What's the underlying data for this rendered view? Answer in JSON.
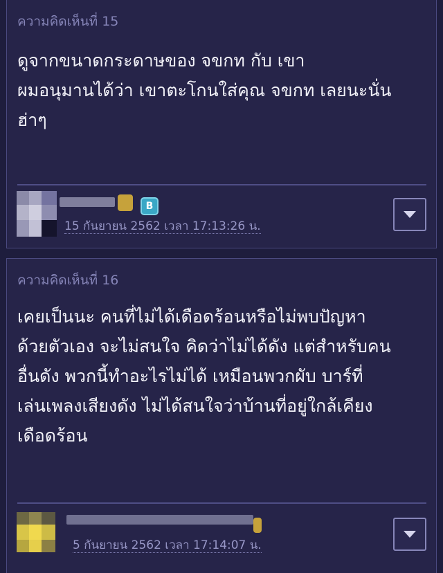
{
  "comments": [
    {
      "title": "ความคิดเห็นที่ 15",
      "body": "ดูจากขนาดกระดาษของ จขกท กับ เขา\nผมอนุมานได้ว่า เขาตะโกนใส่คุณ จขกท เลยนะนั่น\nฮ่าๆ",
      "date": "15 กันยายน 2562 เวลา 17:13:26 น.",
      "badge": "B"
    },
    {
      "title": "ความคิดเห็นที่ 16",
      "body": "เคยเป็นนะ คนที่ไม่ได้เดือดร้อนหรือไม่พบปัญหา\nด้วยตัวเอง จะไม่สนใจ คิดว่าไม่ได้ดัง แต่สำหรับคน\nอื่นดัง พวกนี้ทำอะไรไม่ได้ เหมือนพวกผับ บาร์ที่\nเล่นเพลงเสียงดัง ไม่ได้สนใจว่าบ้านที่อยู่ใกล้เคียง\nเดือดร้อน",
      "date": "5 กันยายน 2562 เวลา 17:14:07 น."
    }
  ],
  "colors": {
    "background": "#1e1d3d",
    "card": "#262449",
    "title": "#8584b7",
    "body_text": "#f1f1f7",
    "date": "#9796c6",
    "border": "#4b4a80"
  },
  "icons": [
    "avatar",
    "member-badge-icon",
    "medal-icon",
    "chevron-down-icon"
  ]
}
